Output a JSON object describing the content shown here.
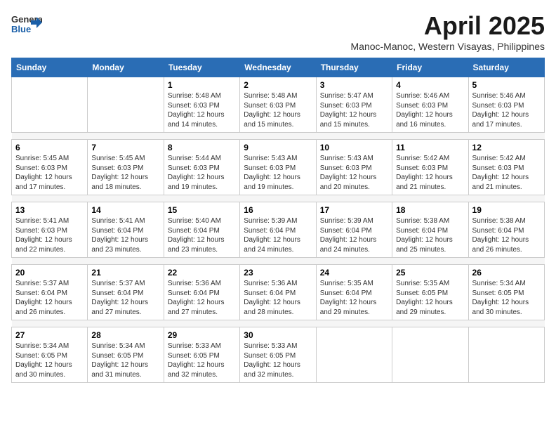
{
  "header": {
    "logo_line1": "General",
    "logo_line2": "Blue",
    "main_title": "April 2025",
    "subtitle": "Manoc-Manoc, Western Visayas, Philippines"
  },
  "weekdays": [
    "Sunday",
    "Monday",
    "Tuesday",
    "Wednesday",
    "Thursday",
    "Friday",
    "Saturday"
  ],
  "weeks": [
    [
      {
        "day": "",
        "sunrise": "",
        "sunset": "",
        "daylight": ""
      },
      {
        "day": "",
        "sunrise": "",
        "sunset": "",
        "daylight": ""
      },
      {
        "day": "1",
        "sunrise": "Sunrise: 5:48 AM",
        "sunset": "Sunset: 6:03 PM",
        "daylight": "Daylight: 12 hours and 14 minutes."
      },
      {
        "day": "2",
        "sunrise": "Sunrise: 5:48 AM",
        "sunset": "Sunset: 6:03 PM",
        "daylight": "Daylight: 12 hours and 15 minutes."
      },
      {
        "day": "3",
        "sunrise": "Sunrise: 5:47 AM",
        "sunset": "Sunset: 6:03 PM",
        "daylight": "Daylight: 12 hours and 15 minutes."
      },
      {
        "day": "4",
        "sunrise": "Sunrise: 5:46 AM",
        "sunset": "Sunset: 6:03 PM",
        "daylight": "Daylight: 12 hours and 16 minutes."
      },
      {
        "day": "5",
        "sunrise": "Sunrise: 5:46 AM",
        "sunset": "Sunset: 6:03 PM",
        "daylight": "Daylight: 12 hours and 17 minutes."
      }
    ],
    [
      {
        "day": "6",
        "sunrise": "Sunrise: 5:45 AM",
        "sunset": "Sunset: 6:03 PM",
        "daylight": "Daylight: 12 hours and 17 minutes."
      },
      {
        "day": "7",
        "sunrise": "Sunrise: 5:45 AM",
        "sunset": "Sunset: 6:03 PM",
        "daylight": "Daylight: 12 hours and 18 minutes."
      },
      {
        "day": "8",
        "sunrise": "Sunrise: 5:44 AM",
        "sunset": "Sunset: 6:03 PM",
        "daylight": "Daylight: 12 hours and 19 minutes."
      },
      {
        "day": "9",
        "sunrise": "Sunrise: 5:43 AM",
        "sunset": "Sunset: 6:03 PM",
        "daylight": "Daylight: 12 hours and 19 minutes."
      },
      {
        "day": "10",
        "sunrise": "Sunrise: 5:43 AM",
        "sunset": "Sunset: 6:03 PM",
        "daylight": "Daylight: 12 hours and 20 minutes."
      },
      {
        "day": "11",
        "sunrise": "Sunrise: 5:42 AM",
        "sunset": "Sunset: 6:03 PM",
        "daylight": "Daylight: 12 hours and 21 minutes."
      },
      {
        "day": "12",
        "sunrise": "Sunrise: 5:42 AM",
        "sunset": "Sunset: 6:03 PM",
        "daylight": "Daylight: 12 hours and 21 minutes."
      }
    ],
    [
      {
        "day": "13",
        "sunrise": "Sunrise: 5:41 AM",
        "sunset": "Sunset: 6:03 PM",
        "daylight": "Daylight: 12 hours and 22 minutes."
      },
      {
        "day": "14",
        "sunrise": "Sunrise: 5:41 AM",
        "sunset": "Sunset: 6:04 PM",
        "daylight": "Daylight: 12 hours and 23 minutes."
      },
      {
        "day": "15",
        "sunrise": "Sunrise: 5:40 AM",
        "sunset": "Sunset: 6:04 PM",
        "daylight": "Daylight: 12 hours and 23 minutes."
      },
      {
        "day": "16",
        "sunrise": "Sunrise: 5:39 AM",
        "sunset": "Sunset: 6:04 PM",
        "daylight": "Daylight: 12 hours and 24 minutes."
      },
      {
        "day": "17",
        "sunrise": "Sunrise: 5:39 AM",
        "sunset": "Sunset: 6:04 PM",
        "daylight": "Daylight: 12 hours and 24 minutes."
      },
      {
        "day": "18",
        "sunrise": "Sunrise: 5:38 AM",
        "sunset": "Sunset: 6:04 PM",
        "daylight": "Daylight: 12 hours and 25 minutes."
      },
      {
        "day": "19",
        "sunrise": "Sunrise: 5:38 AM",
        "sunset": "Sunset: 6:04 PM",
        "daylight": "Daylight: 12 hours and 26 minutes."
      }
    ],
    [
      {
        "day": "20",
        "sunrise": "Sunrise: 5:37 AM",
        "sunset": "Sunset: 6:04 PM",
        "daylight": "Daylight: 12 hours and 26 minutes."
      },
      {
        "day": "21",
        "sunrise": "Sunrise: 5:37 AM",
        "sunset": "Sunset: 6:04 PM",
        "daylight": "Daylight: 12 hours and 27 minutes."
      },
      {
        "day": "22",
        "sunrise": "Sunrise: 5:36 AM",
        "sunset": "Sunset: 6:04 PM",
        "daylight": "Daylight: 12 hours and 27 minutes."
      },
      {
        "day": "23",
        "sunrise": "Sunrise: 5:36 AM",
        "sunset": "Sunset: 6:04 PM",
        "daylight": "Daylight: 12 hours and 28 minutes."
      },
      {
        "day": "24",
        "sunrise": "Sunrise: 5:35 AM",
        "sunset": "Sunset: 6:04 PM",
        "daylight": "Daylight: 12 hours and 29 minutes."
      },
      {
        "day": "25",
        "sunrise": "Sunrise: 5:35 AM",
        "sunset": "Sunset: 6:05 PM",
        "daylight": "Daylight: 12 hours and 29 minutes."
      },
      {
        "day": "26",
        "sunrise": "Sunrise: 5:34 AM",
        "sunset": "Sunset: 6:05 PM",
        "daylight": "Daylight: 12 hours and 30 minutes."
      }
    ],
    [
      {
        "day": "27",
        "sunrise": "Sunrise: 5:34 AM",
        "sunset": "Sunset: 6:05 PM",
        "daylight": "Daylight: 12 hours and 30 minutes."
      },
      {
        "day": "28",
        "sunrise": "Sunrise: 5:34 AM",
        "sunset": "Sunset: 6:05 PM",
        "daylight": "Daylight: 12 hours and 31 minutes."
      },
      {
        "day": "29",
        "sunrise": "Sunrise: 5:33 AM",
        "sunset": "Sunset: 6:05 PM",
        "daylight": "Daylight: 12 hours and 32 minutes."
      },
      {
        "day": "30",
        "sunrise": "Sunrise: 5:33 AM",
        "sunset": "Sunset: 6:05 PM",
        "daylight": "Daylight: 12 hours and 32 minutes."
      },
      {
        "day": "",
        "sunrise": "",
        "sunset": "",
        "daylight": ""
      },
      {
        "day": "",
        "sunrise": "",
        "sunset": "",
        "daylight": ""
      },
      {
        "day": "",
        "sunrise": "",
        "sunset": "",
        "daylight": ""
      }
    ]
  ]
}
